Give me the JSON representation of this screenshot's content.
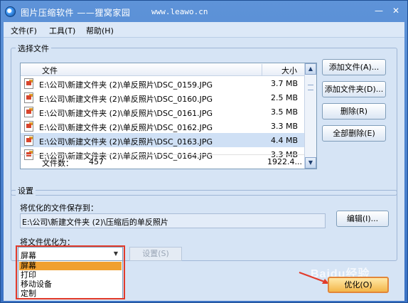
{
  "window": {
    "title": "图片压缩软件",
    "subtitle": "——狸窝家园",
    "url": "www.leawo.cn",
    "minimize_glyph": "—",
    "close_glyph": "✕"
  },
  "menu": [
    "文件(F)",
    "工具(T)",
    "帮助(H)"
  ],
  "file_section": {
    "title": "选择文件",
    "columns": {
      "file": "文件",
      "size": "大小"
    },
    "rows": [
      {
        "path": "E:\\公司\\新建文件夹 (2)\\单反照片\\DSC_0159.JPG",
        "size": "3.7 MB"
      },
      {
        "path": "E:\\公司\\新建文件夹 (2)\\单反照片\\DSC_0160.JPG",
        "size": "2.5 MB"
      },
      {
        "path": "E:\\公司\\新建文件夹 (2)\\单反照片\\DSC_0161.JPG",
        "size": "3.5 MB"
      },
      {
        "path": "E:\\公司\\新建文件夹 (2)\\单反照片\\DSC_0162.JPG",
        "size": "3.3 MB"
      },
      {
        "path": "E:\\公司\\新建文件夹 (2)\\单反照片\\DSC_0163.JPG",
        "size": "4.4 MB"
      },
      {
        "path": "E:\\公司\\新建文件夹 (2)\\单反照片\\DSC_0164.JPG",
        "size": "3.3 MB"
      }
    ],
    "selected_row": 4,
    "file_count_label": "文件数：",
    "file_count": "457",
    "total_size": "1922.4...",
    "buttons": {
      "add_file": "添加文件(A)...",
      "add_folder": "添加文件夹(D)...",
      "delete": "删除(R)",
      "delete_all": "全部删除(E)"
    }
  },
  "settings_section": {
    "title": "设置",
    "save_to_label": "将优化的文件保存到：",
    "save_path": "E:\\公司\\新建文件夹 (2)\\压缩后的单反照片",
    "edit_button": "编辑(I)...",
    "optimize_for_label": "将文件优化为：",
    "target_value": "屏幕",
    "target_options": [
      "屏幕",
      "打印",
      "移动设备",
      "定制"
    ],
    "settings_button": "设置(S)"
  },
  "optimize_button": "优化(O)",
  "watermark": "Baidu经验",
  "colors": {
    "title_bar": "#3a72c4",
    "client_bg": "#d6e4f5",
    "highlight_red": "#e23a2a",
    "selected_option": "#f0a030",
    "optimize_button": "#f3b64a"
  }
}
